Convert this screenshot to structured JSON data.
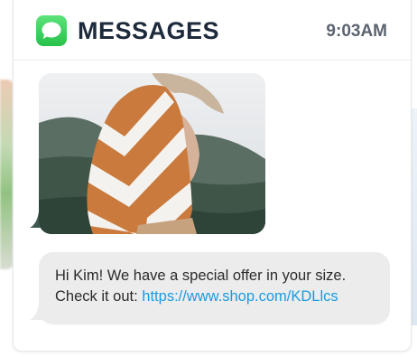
{
  "app": {
    "title": "MESSAGES",
    "time": "9:03AM",
    "icon": "message-bubble-icon",
    "icon_color": "#34c759"
  },
  "messages": [
    {
      "type": "image",
      "image": "photo-woman-orange-white-sweater"
    },
    {
      "type": "text",
      "line1": "Hi Kim! We have a special offer in your size.",
      "line2_prefix": "Check it out: ",
      "link": "https://www.shop.com/KDLlcs",
      "link_color": "#1a9be0",
      "bubble_color": "#ececec"
    }
  ]
}
